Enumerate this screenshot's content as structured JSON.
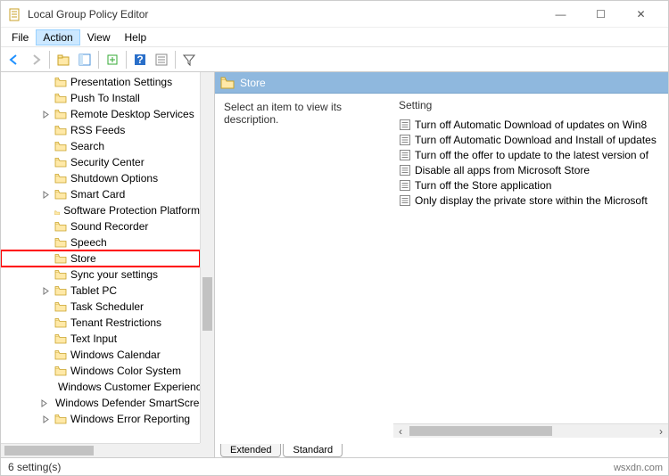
{
  "window": {
    "title": "Local Group Policy Editor",
    "min_icon": "—",
    "max_icon": "☐",
    "close_icon": "✕"
  },
  "menu": {
    "items": [
      "File",
      "Action",
      "View",
      "Help"
    ],
    "active_index": 1
  },
  "toolbar": {
    "icons": [
      "back",
      "forward",
      "up",
      "properties",
      "refresh",
      "help",
      "options",
      "filter"
    ]
  },
  "tree": {
    "nodes": [
      {
        "label": "Presentation Settings",
        "expand": false,
        "highlight": false
      },
      {
        "label": "Push To Install",
        "expand": false,
        "highlight": false
      },
      {
        "label": "Remote Desktop Services",
        "expand": true,
        "highlight": false
      },
      {
        "label": "RSS Feeds",
        "expand": false,
        "highlight": false
      },
      {
        "label": "Search",
        "expand": false,
        "highlight": false
      },
      {
        "label": "Security Center",
        "expand": false,
        "highlight": false
      },
      {
        "label": "Shutdown Options",
        "expand": false,
        "highlight": false
      },
      {
        "label": "Smart Card",
        "expand": true,
        "highlight": false
      },
      {
        "label": "Software Protection Platform",
        "expand": false,
        "highlight": false
      },
      {
        "label": "Sound Recorder",
        "expand": false,
        "highlight": false
      },
      {
        "label": "Speech",
        "expand": false,
        "highlight": false
      },
      {
        "label": "Store",
        "expand": false,
        "highlight": true
      },
      {
        "label": "Sync your settings",
        "expand": false,
        "highlight": false
      },
      {
        "label": "Tablet PC",
        "expand": true,
        "highlight": false
      },
      {
        "label": "Task Scheduler",
        "expand": false,
        "highlight": false
      },
      {
        "label": "Tenant Restrictions",
        "expand": false,
        "highlight": false
      },
      {
        "label": "Text Input",
        "expand": false,
        "highlight": false
      },
      {
        "label": "Windows Calendar",
        "expand": false,
        "highlight": false
      },
      {
        "label": "Windows Color System",
        "expand": false,
        "highlight": false
      },
      {
        "label": "Windows Customer Experience",
        "expand": false,
        "highlight": false
      },
      {
        "label": "Windows Defender SmartScreen",
        "expand": true,
        "highlight": false
      },
      {
        "label": "Windows Error Reporting",
        "expand": true,
        "highlight": false
      }
    ]
  },
  "detail": {
    "heading": "Store",
    "description": "Select an item to view its description.",
    "column_header": "Setting",
    "settings": [
      "Turn off Automatic Download of updates on Win8",
      "Turn off Automatic Download and Install of updates",
      "Turn off the offer to update to the latest version of",
      "Disable all apps from Microsoft Store",
      "Turn off the Store application",
      "Only display the private store within the Microsoft"
    ]
  },
  "tabs": {
    "extended": "Extended",
    "standard": "Standard"
  },
  "status": {
    "text": "6 setting(s)"
  },
  "watermark": "wsxdn.com"
}
